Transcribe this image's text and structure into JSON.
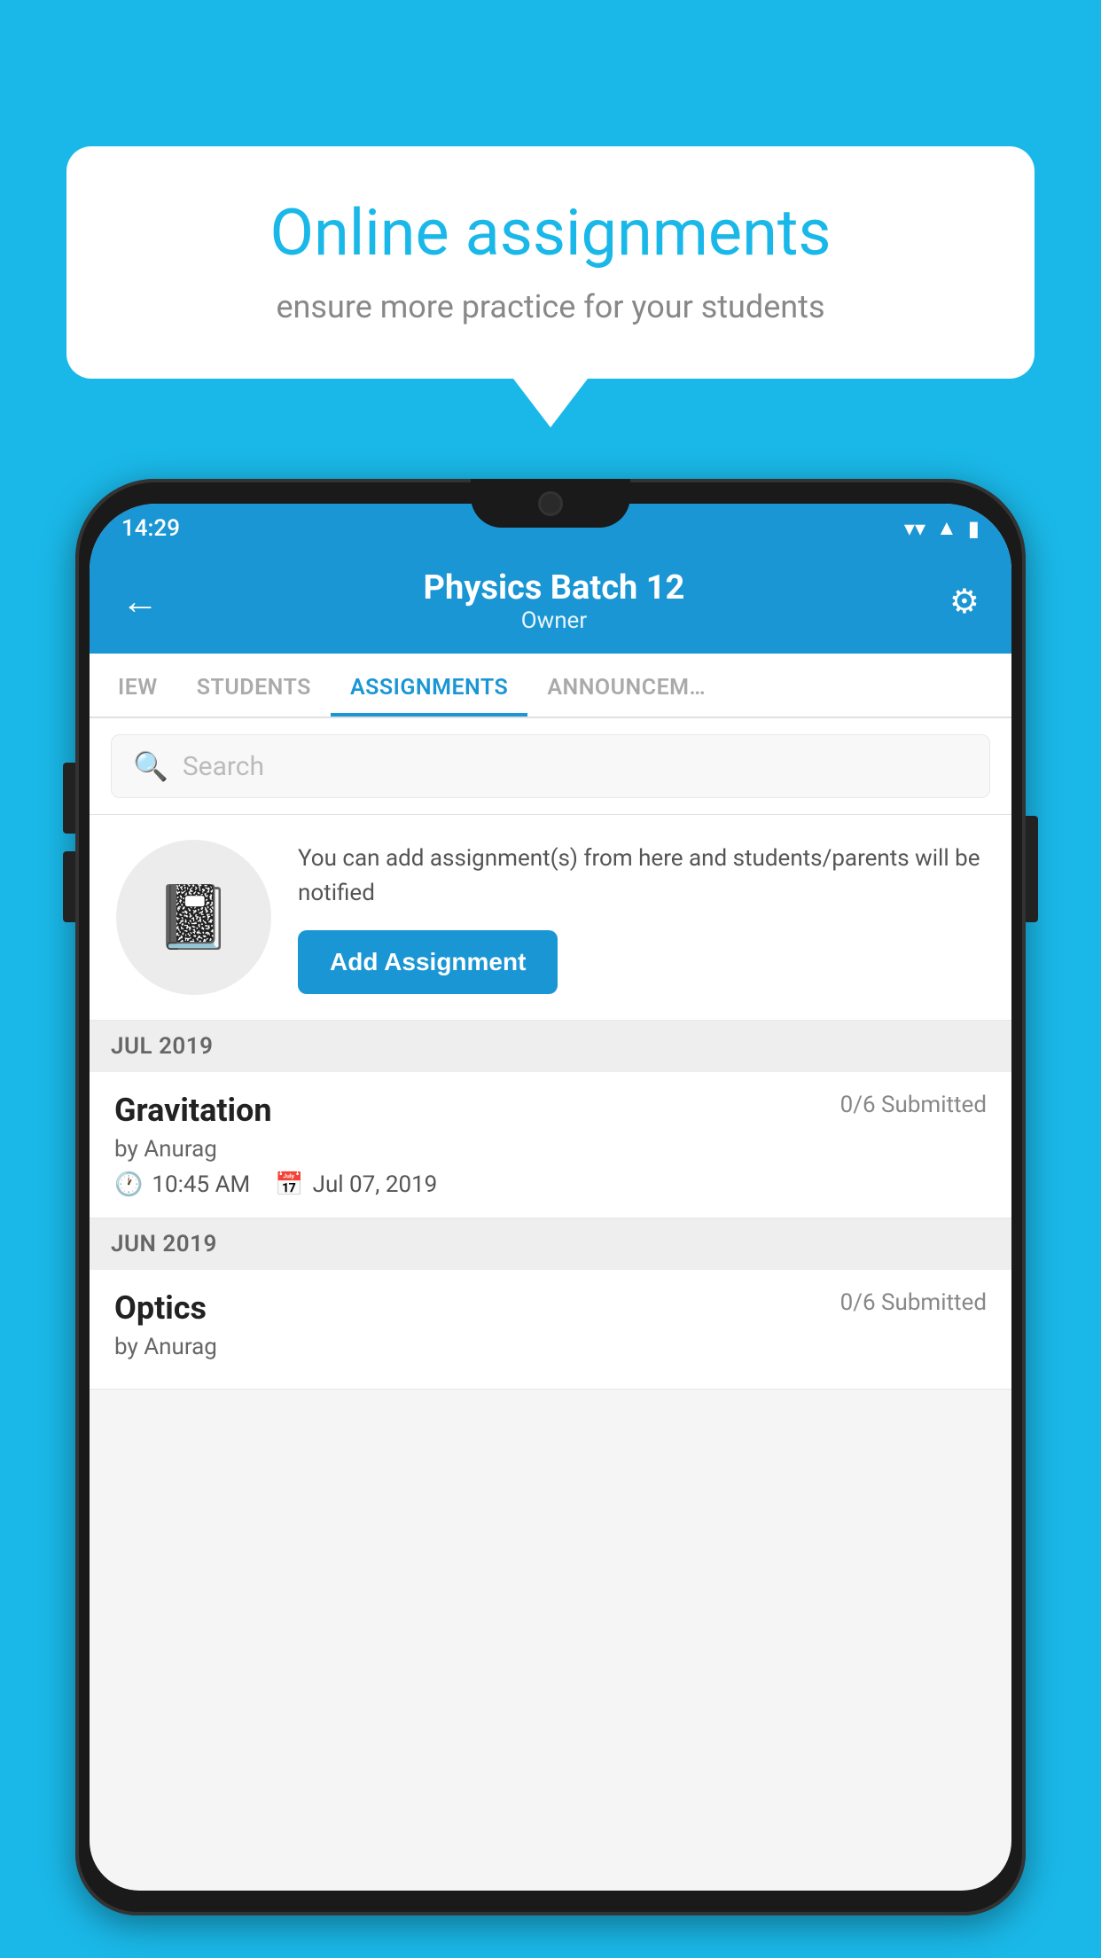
{
  "background_color": "#1ab8e8",
  "speech_bubble": {
    "title": "Online assignments",
    "subtitle": "ensure more practice for your students"
  },
  "status_bar": {
    "time": "14:29",
    "wifi": "▼",
    "signal": "▲",
    "battery": "▮"
  },
  "header": {
    "title": "Physics Batch 12",
    "subtitle": "Owner",
    "back_label": "←",
    "settings_label": "⚙"
  },
  "tabs": [
    {
      "label": "IEW",
      "active": false
    },
    {
      "label": "STUDENTS",
      "active": false
    },
    {
      "label": "ASSIGNMENTS",
      "active": true
    },
    {
      "label": "ANNOUNCEM…",
      "active": false
    }
  ],
  "search": {
    "placeholder": "Search"
  },
  "promo": {
    "text": "You can add assignment(s) from here and students/parents will be notified",
    "button_label": "Add Assignment"
  },
  "sections": [
    {
      "header": "JUL 2019",
      "assignments": [
        {
          "title": "Gravitation",
          "submitted": "0/6 Submitted",
          "by": "by Anurag",
          "time": "10:45 AM",
          "date": "Jul 07, 2019"
        }
      ]
    },
    {
      "header": "JUN 2019",
      "assignments": [
        {
          "title": "Optics",
          "submitted": "0/6 Submitted",
          "by": "by Anurag",
          "time": "",
          "date": ""
        }
      ]
    }
  ]
}
